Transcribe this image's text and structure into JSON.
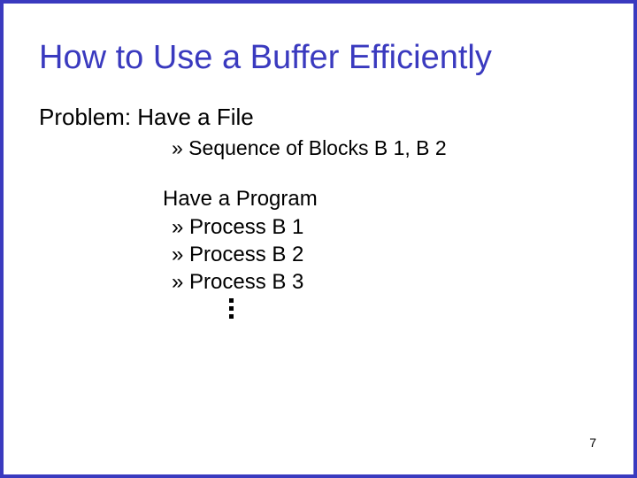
{
  "title": "How to Use a Buffer Efficiently",
  "subtitle": "Problem: Have a File",
  "bullet_file": "» Sequence of Blocks B 1, B 2",
  "program_heading": "Have a Program",
  "program_steps": {
    "s1": "» Process B 1",
    "s2": "» Process B 2",
    "s3": "» Process B 3"
  },
  "page_number": "7"
}
